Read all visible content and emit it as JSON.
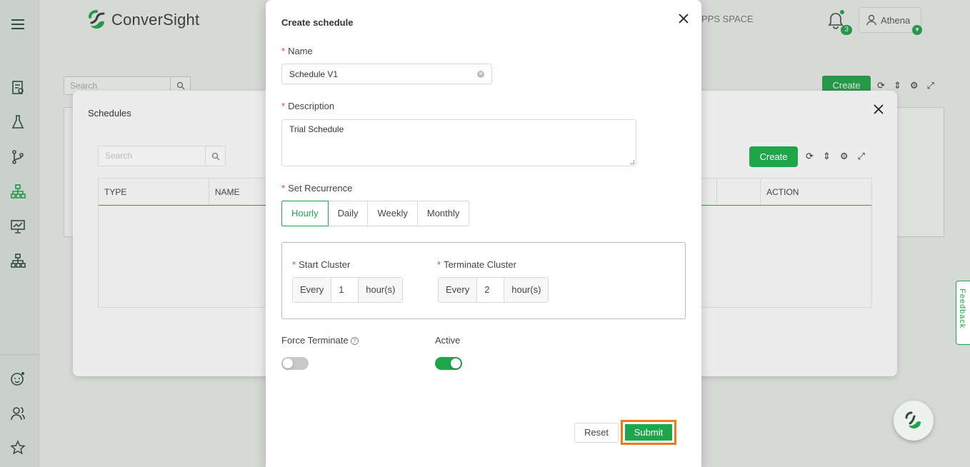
{
  "app": {
    "logo_text": "ConverSight",
    "apps_space": "PPS SPACE",
    "notification_count": "3",
    "user_name": "Athena"
  },
  "background": {
    "search_placeholder": "Search",
    "create_label": "Create"
  },
  "schedules_panel": {
    "title": "Schedules",
    "search_placeholder": "Search",
    "create_label": "Create",
    "columns": [
      "TYPE",
      "NAME",
      "ACTION"
    ]
  },
  "modal": {
    "title": "Create schedule",
    "name_label": "Name",
    "name_value": "Schedule V1",
    "description_label": "Description",
    "description_value": "Trial Schedule",
    "recurrence_label": "Set Recurrence",
    "recurrence_options": [
      "Hourly",
      "Daily",
      "Weekly",
      "Monthly"
    ],
    "recurrence_selected": "Hourly",
    "start_cluster": {
      "label": "Start Cluster",
      "prefix": "Every",
      "value": "1",
      "suffix": "hour(s)"
    },
    "terminate_cluster": {
      "label": "Terminate Cluster",
      "prefix": "Every",
      "value": "2",
      "suffix": "hour(s)"
    },
    "force_terminate_label": "Force Terminate",
    "force_terminate_on": false,
    "active_label": "Active",
    "active_on": true,
    "reset_label": "Reset",
    "submit_label": "Submit"
  },
  "feedback_label": "Feedback",
  "colors": {
    "accent": "#1ea64a",
    "highlight": "#f07a1a"
  }
}
